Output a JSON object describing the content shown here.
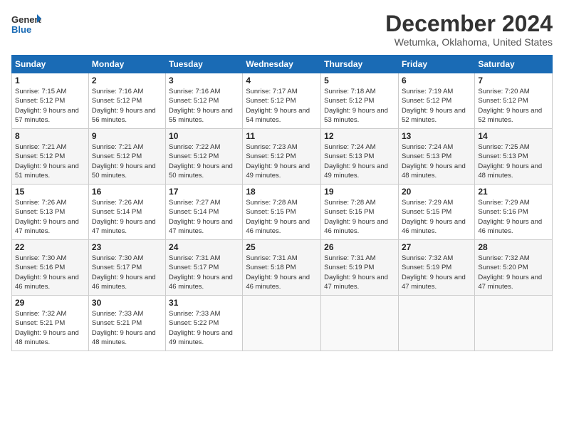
{
  "logo": {
    "line1": "General",
    "line2": "Blue"
  },
  "title": "December 2024",
  "subtitle": "Wetumka, Oklahoma, United States",
  "days_header": [
    "Sunday",
    "Monday",
    "Tuesday",
    "Wednesday",
    "Thursday",
    "Friday",
    "Saturday"
  ],
  "weeks": [
    [
      {
        "day": "1",
        "sunrise": "Sunrise: 7:15 AM",
        "sunset": "Sunset: 5:12 PM",
        "daylight": "Daylight: 9 hours and 57 minutes."
      },
      {
        "day": "2",
        "sunrise": "Sunrise: 7:16 AM",
        "sunset": "Sunset: 5:12 PM",
        "daylight": "Daylight: 9 hours and 56 minutes."
      },
      {
        "day": "3",
        "sunrise": "Sunrise: 7:16 AM",
        "sunset": "Sunset: 5:12 PM",
        "daylight": "Daylight: 9 hours and 55 minutes."
      },
      {
        "day": "4",
        "sunrise": "Sunrise: 7:17 AM",
        "sunset": "Sunset: 5:12 PM",
        "daylight": "Daylight: 9 hours and 54 minutes."
      },
      {
        "day": "5",
        "sunrise": "Sunrise: 7:18 AM",
        "sunset": "Sunset: 5:12 PM",
        "daylight": "Daylight: 9 hours and 53 minutes."
      },
      {
        "day": "6",
        "sunrise": "Sunrise: 7:19 AM",
        "sunset": "Sunset: 5:12 PM",
        "daylight": "Daylight: 9 hours and 52 minutes."
      },
      {
        "day": "7",
        "sunrise": "Sunrise: 7:20 AM",
        "sunset": "Sunset: 5:12 PM",
        "daylight": "Daylight: 9 hours and 52 minutes."
      }
    ],
    [
      {
        "day": "8",
        "sunrise": "Sunrise: 7:21 AM",
        "sunset": "Sunset: 5:12 PM",
        "daylight": "Daylight: 9 hours and 51 minutes."
      },
      {
        "day": "9",
        "sunrise": "Sunrise: 7:21 AM",
        "sunset": "Sunset: 5:12 PM",
        "daylight": "Daylight: 9 hours and 50 minutes."
      },
      {
        "day": "10",
        "sunrise": "Sunrise: 7:22 AM",
        "sunset": "Sunset: 5:12 PM",
        "daylight": "Daylight: 9 hours and 50 minutes."
      },
      {
        "day": "11",
        "sunrise": "Sunrise: 7:23 AM",
        "sunset": "Sunset: 5:12 PM",
        "daylight": "Daylight: 9 hours and 49 minutes."
      },
      {
        "day": "12",
        "sunrise": "Sunrise: 7:24 AM",
        "sunset": "Sunset: 5:13 PM",
        "daylight": "Daylight: 9 hours and 49 minutes."
      },
      {
        "day": "13",
        "sunrise": "Sunrise: 7:24 AM",
        "sunset": "Sunset: 5:13 PM",
        "daylight": "Daylight: 9 hours and 48 minutes."
      },
      {
        "day": "14",
        "sunrise": "Sunrise: 7:25 AM",
        "sunset": "Sunset: 5:13 PM",
        "daylight": "Daylight: 9 hours and 48 minutes."
      }
    ],
    [
      {
        "day": "15",
        "sunrise": "Sunrise: 7:26 AM",
        "sunset": "Sunset: 5:13 PM",
        "daylight": "Daylight: 9 hours and 47 minutes."
      },
      {
        "day": "16",
        "sunrise": "Sunrise: 7:26 AM",
        "sunset": "Sunset: 5:14 PM",
        "daylight": "Daylight: 9 hours and 47 minutes."
      },
      {
        "day": "17",
        "sunrise": "Sunrise: 7:27 AM",
        "sunset": "Sunset: 5:14 PM",
        "daylight": "Daylight: 9 hours and 47 minutes."
      },
      {
        "day": "18",
        "sunrise": "Sunrise: 7:28 AM",
        "sunset": "Sunset: 5:15 PM",
        "daylight": "Daylight: 9 hours and 46 minutes."
      },
      {
        "day": "19",
        "sunrise": "Sunrise: 7:28 AM",
        "sunset": "Sunset: 5:15 PM",
        "daylight": "Daylight: 9 hours and 46 minutes."
      },
      {
        "day": "20",
        "sunrise": "Sunrise: 7:29 AM",
        "sunset": "Sunset: 5:15 PM",
        "daylight": "Daylight: 9 hours and 46 minutes."
      },
      {
        "day": "21",
        "sunrise": "Sunrise: 7:29 AM",
        "sunset": "Sunset: 5:16 PM",
        "daylight": "Daylight: 9 hours and 46 minutes."
      }
    ],
    [
      {
        "day": "22",
        "sunrise": "Sunrise: 7:30 AM",
        "sunset": "Sunset: 5:16 PM",
        "daylight": "Daylight: 9 hours and 46 minutes."
      },
      {
        "day": "23",
        "sunrise": "Sunrise: 7:30 AM",
        "sunset": "Sunset: 5:17 PM",
        "daylight": "Daylight: 9 hours and 46 minutes."
      },
      {
        "day": "24",
        "sunrise": "Sunrise: 7:31 AM",
        "sunset": "Sunset: 5:17 PM",
        "daylight": "Daylight: 9 hours and 46 minutes."
      },
      {
        "day": "25",
        "sunrise": "Sunrise: 7:31 AM",
        "sunset": "Sunset: 5:18 PM",
        "daylight": "Daylight: 9 hours and 46 minutes."
      },
      {
        "day": "26",
        "sunrise": "Sunrise: 7:31 AM",
        "sunset": "Sunset: 5:19 PM",
        "daylight": "Daylight: 9 hours and 47 minutes."
      },
      {
        "day": "27",
        "sunrise": "Sunrise: 7:32 AM",
        "sunset": "Sunset: 5:19 PM",
        "daylight": "Daylight: 9 hours and 47 minutes."
      },
      {
        "day": "28",
        "sunrise": "Sunrise: 7:32 AM",
        "sunset": "Sunset: 5:20 PM",
        "daylight": "Daylight: 9 hours and 47 minutes."
      }
    ],
    [
      {
        "day": "29",
        "sunrise": "Sunrise: 7:32 AM",
        "sunset": "Sunset: 5:21 PM",
        "daylight": "Daylight: 9 hours and 48 minutes."
      },
      {
        "day": "30",
        "sunrise": "Sunrise: 7:33 AM",
        "sunset": "Sunset: 5:21 PM",
        "daylight": "Daylight: 9 hours and 48 minutes."
      },
      {
        "day": "31",
        "sunrise": "Sunrise: 7:33 AM",
        "sunset": "Sunset: 5:22 PM",
        "daylight": "Daylight: 9 hours and 49 minutes."
      },
      null,
      null,
      null,
      null
    ]
  ]
}
